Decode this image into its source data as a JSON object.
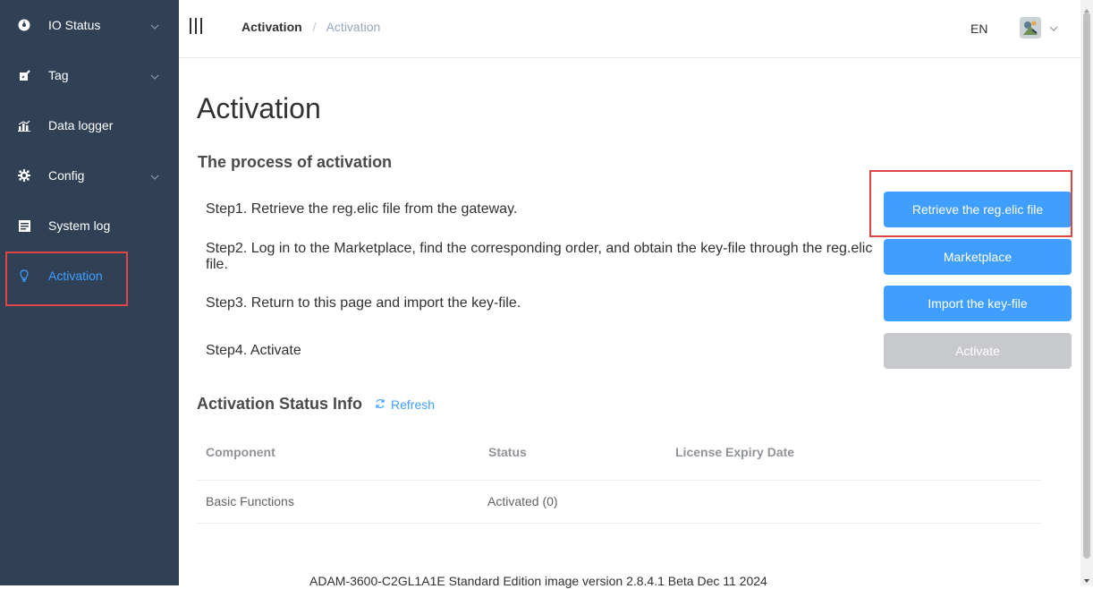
{
  "sidebar": {
    "items": [
      {
        "label": "IO Status",
        "icon": "compass-icon",
        "has_submenu": true
      },
      {
        "label": "Tag",
        "icon": "edit-icon",
        "has_submenu": true
      },
      {
        "label": "Data logger",
        "icon": "chart-icon",
        "has_submenu": false
      },
      {
        "label": "Config",
        "icon": "gear-icon",
        "has_submenu": true
      },
      {
        "label": "System log",
        "icon": "log-icon",
        "has_submenu": false
      },
      {
        "label": "Activation",
        "icon": "bulb-icon",
        "has_submenu": false,
        "active": true
      }
    ]
  },
  "header": {
    "breadcrumb": [
      "Activation",
      "Activation"
    ],
    "language": "EN"
  },
  "main": {
    "title": "Activation",
    "process_title": "The process of activation",
    "steps": [
      {
        "text": "Step1. Retrieve the reg.elic file from the gateway.",
        "button": "Retrieve the reg.elic file",
        "enabled": true
      },
      {
        "text": "Step2. Log in to the Marketplace, find the corresponding order, and obtain the key-file through the reg.elic file.",
        "button": "Marketplace",
        "enabled": true
      },
      {
        "text": "Step3. Return to this page and import the key-file.",
        "button": "Import the key-file",
        "enabled": true
      },
      {
        "text": "Step4. Activate",
        "button": "Activate",
        "enabled": false
      }
    ],
    "status_title": "Activation Status Info",
    "refresh_label": "Refresh",
    "table": {
      "headers": [
        "Component",
        "Status",
        "License Expiry Date"
      ],
      "rows": [
        [
          "Basic Functions",
          "Activated (0)",
          ""
        ]
      ]
    },
    "footer": "ADAM-3600-C2GL1A1E Standard Edition image version 2.8.4.1 Beta Dec 11 2024"
  },
  "colors": {
    "sidebar_bg": "#304156",
    "accent": "#409eff",
    "highlight": "#e04444",
    "disabled": "#c8c9cc"
  }
}
